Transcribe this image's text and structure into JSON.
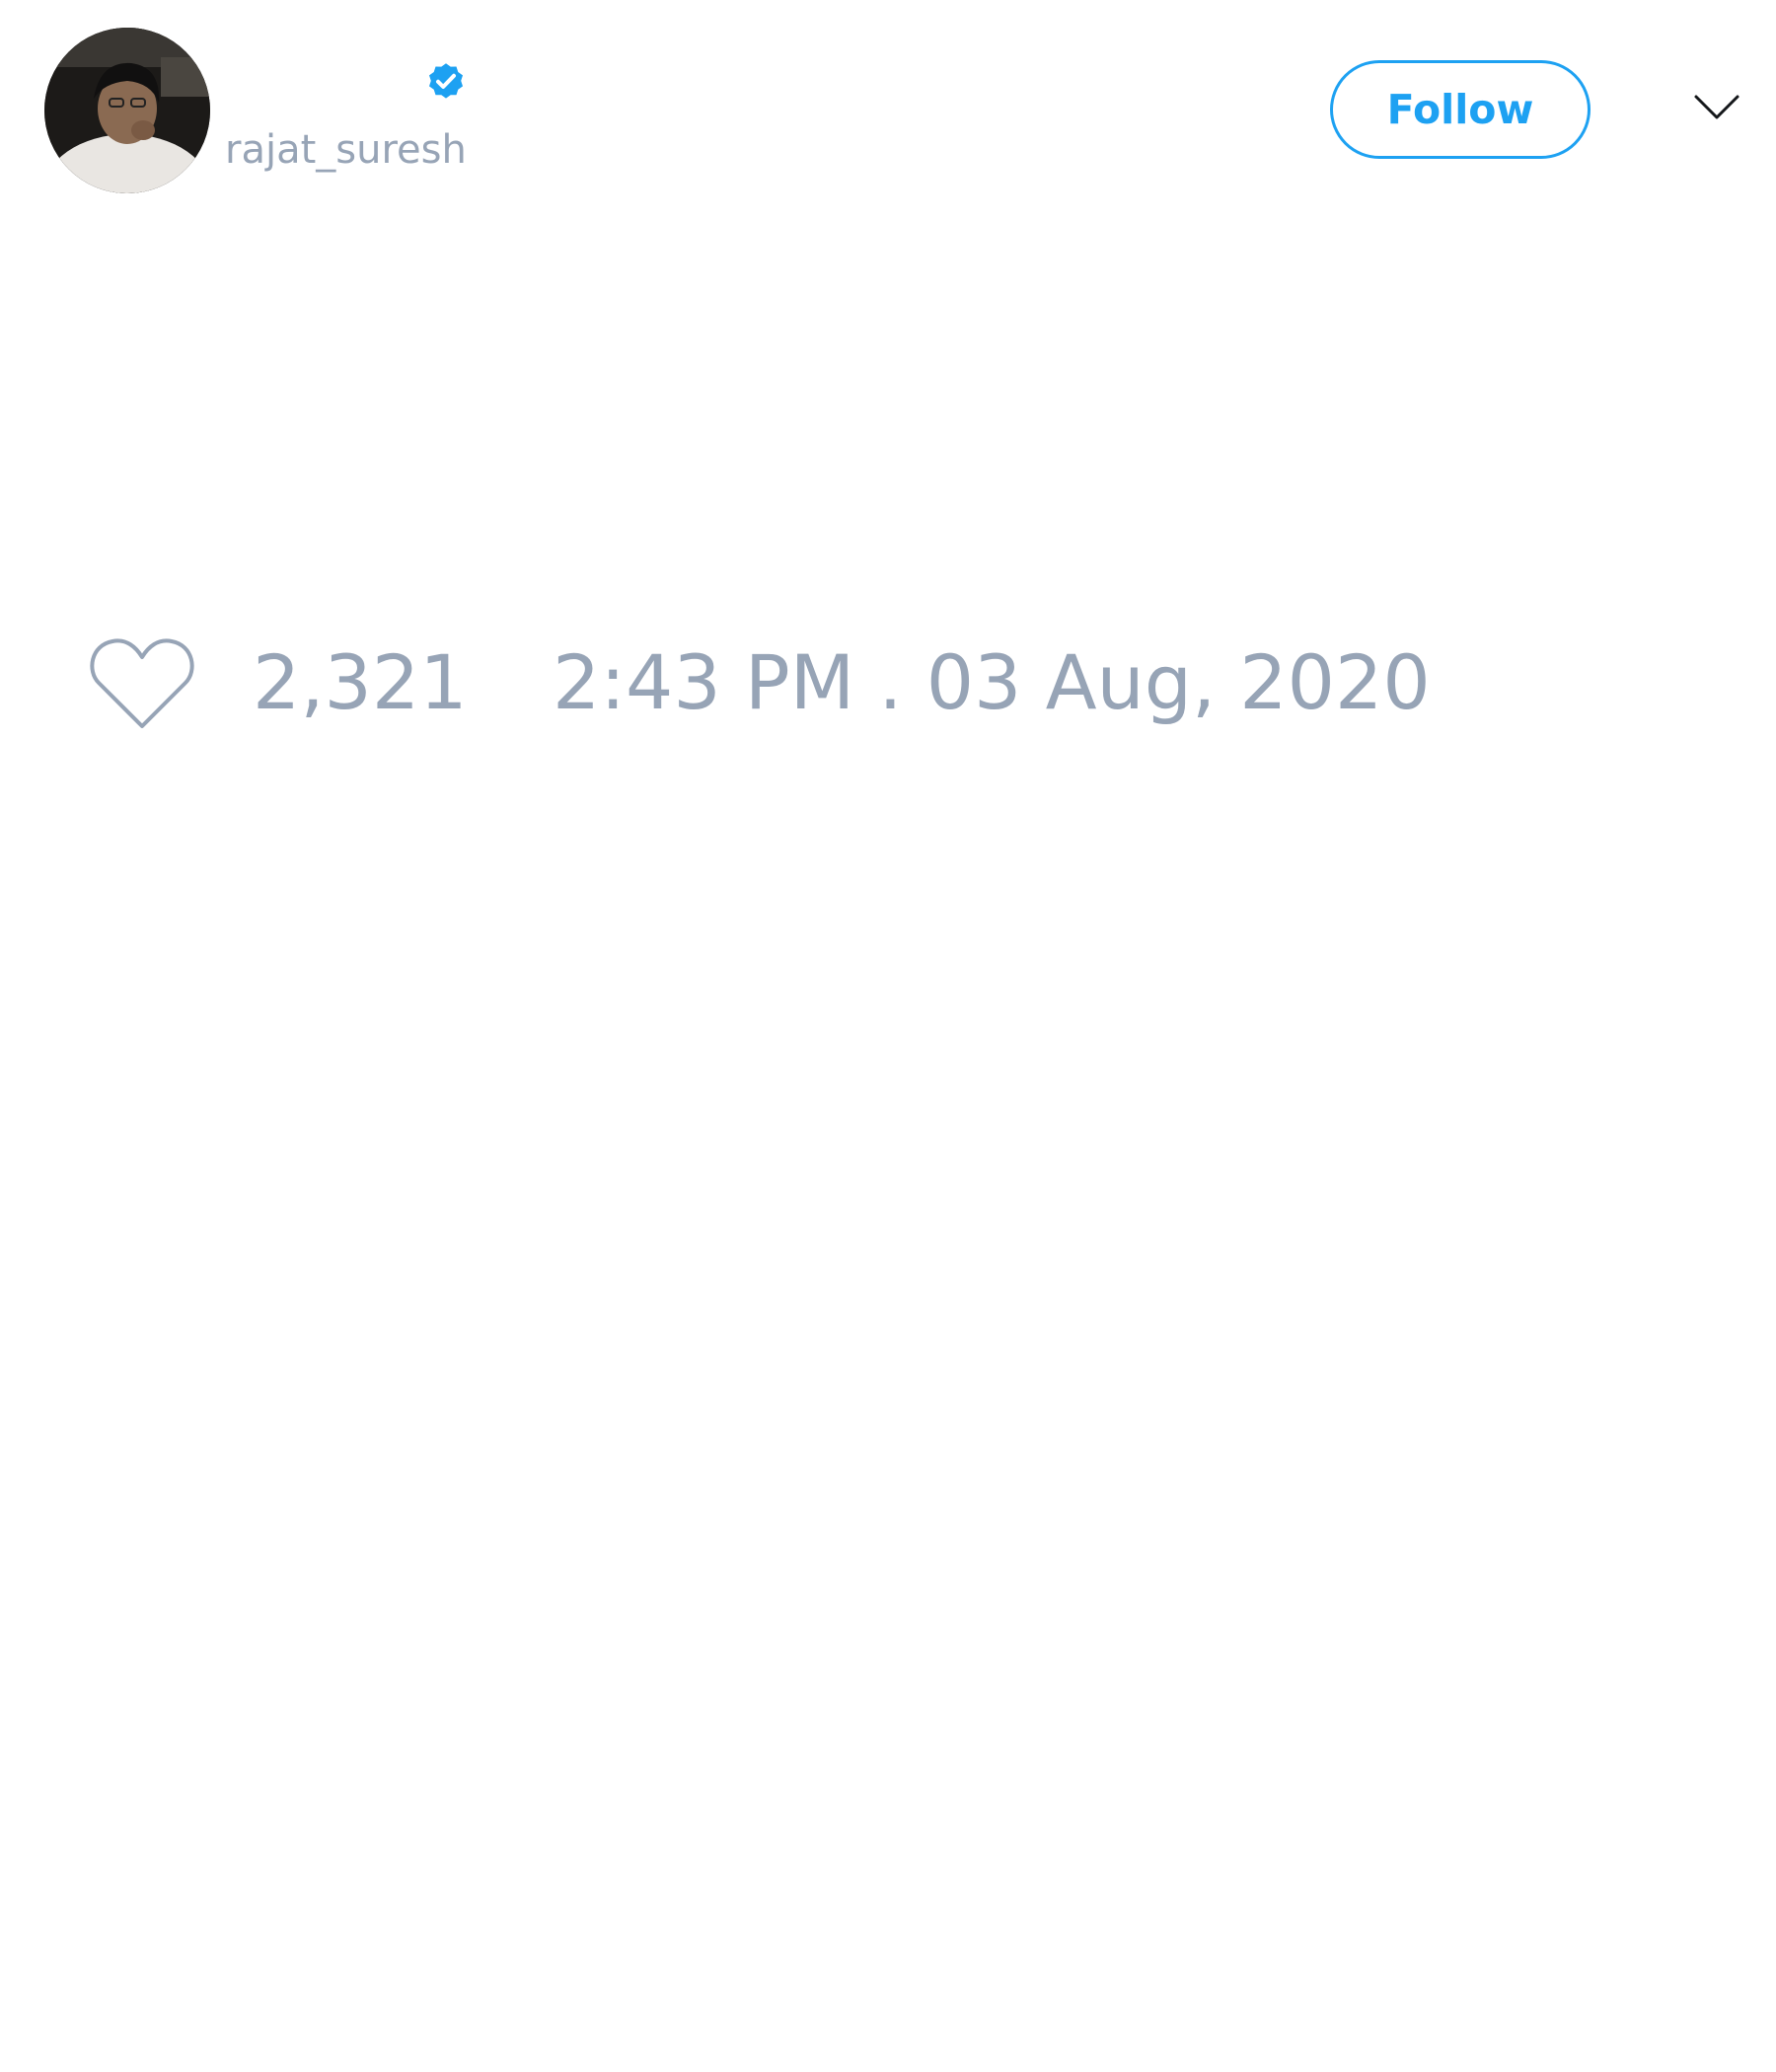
{
  "tweet": {
    "author": {
      "handle": "rajat_suresh",
      "verified": true,
      "avatar": "profile-photo"
    },
    "follow_label": "Follow",
    "menu_icon": "chevron-down-icon",
    "like_icon": "heart-outline-icon",
    "like_count": "2,321",
    "timestamp": "2:43 PM . 03 Aug, 2020"
  },
  "colors": {
    "accent": "#1da1f2",
    "muted_text": "#97a4b6",
    "background": "#ffffff"
  }
}
